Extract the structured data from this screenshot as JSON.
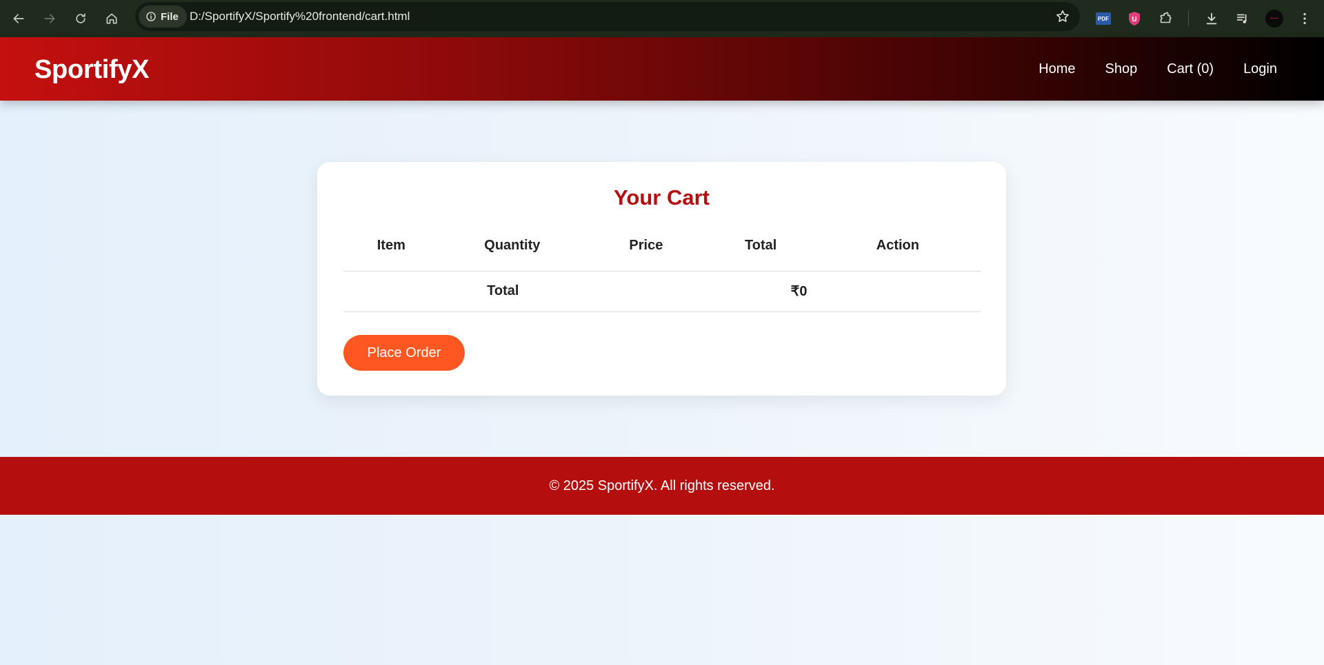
{
  "browser": {
    "site_chip": "File",
    "url": "D:/SportifyX/Sportify%20frontend/cart.html",
    "extensions": {
      "pdf_label": "PDF",
      "ublock_label": "U"
    },
    "colors": {
      "chrome": "#1f2b1d",
      "omnibox": "#131c12"
    }
  },
  "site": {
    "brand": "SportifyX",
    "nav": [
      "Home",
      "Shop",
      "Cart (0)",
      "Login"
    ]
  },
  "cart": {
    "title": "Your Cart",
    "columns": [
      "Item",
      "Quantity",
      "Price",
      "Total",
      "Action"
    ],
    "total_label": "Total",
    "total_value": "₹0",
    "place_order_label": "Place Order"
  },
  "footer": {
    "text": "© 2025 SportifyX. All rights reserved."
  },
  "theme": {
    "accent": "#b40e0e",
    "button": "#ff5722",
    "header_gradient": [
      "#c4100f",
      "#000000"
    ]
  }
}
